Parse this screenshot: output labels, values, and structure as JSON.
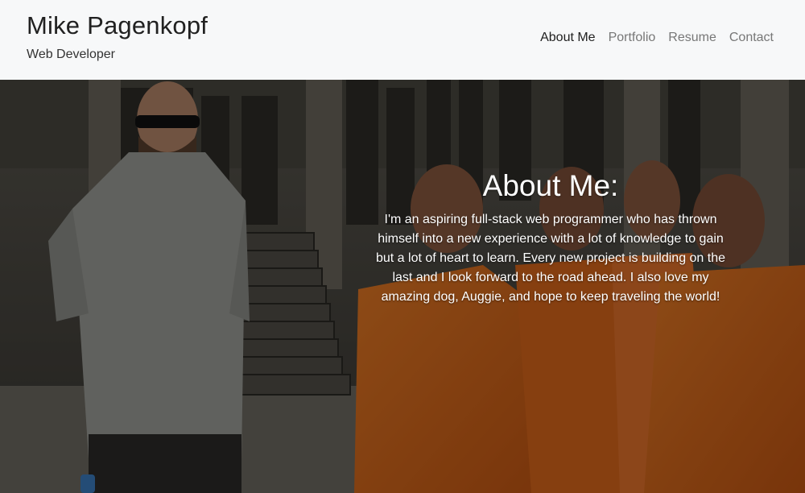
{
  "header": {
    "name": "Mike Pagenkopf",
    "subtitle": "Web Developer"
  },
  "nav": {
    "items": [
      {
        "label": "About Me",
        "active": true
      },
      {
        "label": "Portfolio",
        "active": false
      },
      {
        "label": "Resume",
        "active": false
      },
      {
        "label": "Contact",
        "active": false
      }
    ]
  },
  "about": {
    "title": "About Me:",
    "text": "I'm an aspiring full-stack web programmer who has thrown himself into a new experience with a lot of knowledge to gain but a lot of heart to learn. Every new project is building on the last and I look forward to the road ahead. I also love my amazing dog, Auggie, and hope to keep traveling the world!"
  },
  "colors": {
    "navbar_bg": "#f7f8f9",
    "nav_active": "#212121",
    "nav_inactive": "#777777",
    "robe_orange": "#d9651a"
  }
}
